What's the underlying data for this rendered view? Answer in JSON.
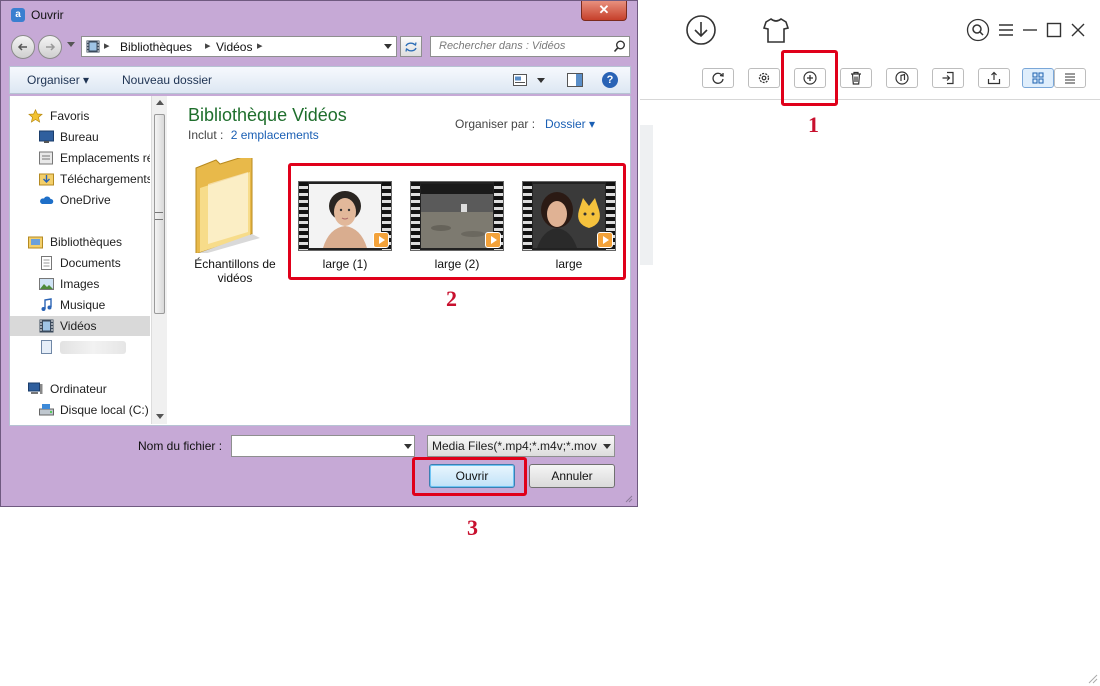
{
  "dialog": {
    "title": "Ouvrir",
    "close_label": "✕",
    "breadcrumb": [
      "Bibliothèques",
      "Vidéos"
    ],
    "search_placeholder": "Rechercher dans : Vidéos",
    "toolbar": {
      "organize": "Organiser ▾",
      "new_folder": "Nouveau dossier"
    },
    "nav": {
      "favorites": {
        "header": "Favoris",
        "items": [
          "Bureau",
          "Emplacements ré",
          "Téléchargements",
          "OneDrive"
        ]
      },
      "libraries": {
        "header": "Bibliothèques",
        "items": [
          "Documents",
          "Images",
          "Musique",
          "Vidéos"
        ],
        "selected": "Vidéos"
      },
      "computer": {
        "header": "Ordinateur",
        "items": [
          "Disque local (C:)"
        ]
      }
    },
    "library": {
      "title": "Bibliothèque Vidéos",
      "includes_label": "Inclut :",
      "includes_link": "2 emplacements",
      "arrange_label": "Organiser par :",
      "arrange_value": "Dossier ▾"
    },
    "files": [
      {
        "name": "Échantillons de vidéos",
        "type": "folder"
      },
      {
        "name": "large (1)",
        "type": "video"
      },
      {
        "name": "large (2)",
        "type": "video"
      },
      {
        "name": "large",
        "type": "video"
      }
    ],
    "filename_label": "Nom du fichier :",
    "filename_value": "",
    "filetype_value": "Media Files(*.mp4;*.m4v;*.mov",
    "open_button": "Ouvrir",
    "cancel_button": "Annuler"
  },
  "annotations": {
    "step1": "1",
    "step2": "2",
    "step3": "3",
    "color": "#e0001a"
  },
  "app_toolbar": [
    "refresh-icon",
    "settings-icon",
    "add-icon",
    "delete-icon",
    "to-itunes-icon",
    "import-icon",
    "export-icon",
    "grid-view-icon",
    "list-view-icon"
  ]
}
